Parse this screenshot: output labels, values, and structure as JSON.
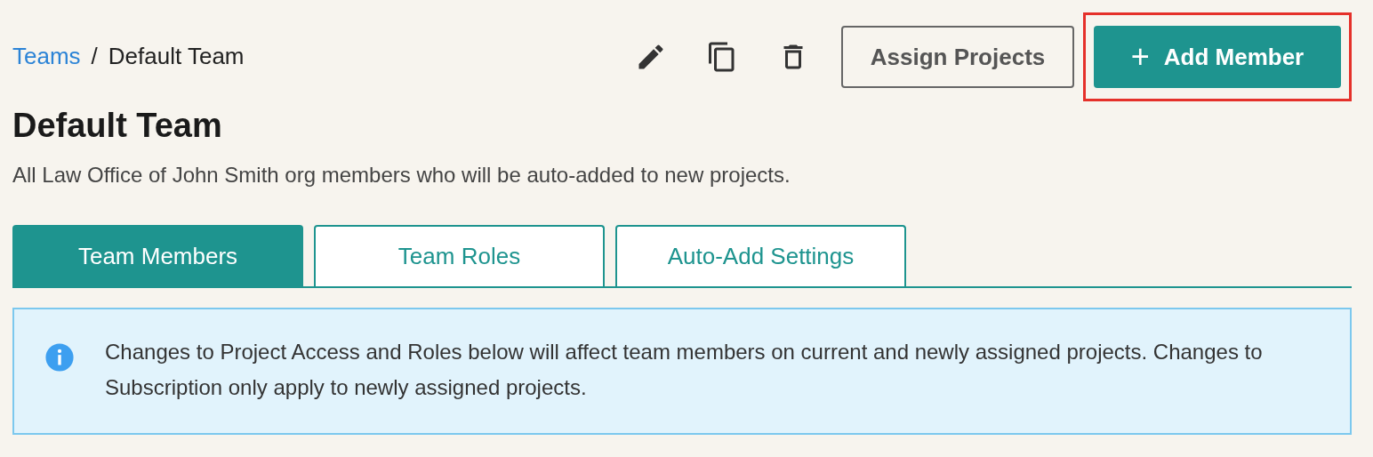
{
  "breadcrumb": {
    "parent": "Teams",
    "separator": "/",
    "current": "Default Team"
  },
  "toolbar": {
    "icons": [
      {
        "kind": "edit"
      },
      {
        "kind": "copy"
      },
      {
        "kind": "delete"
      }
    ],
    "buttons": [
      {
        "label": "Assign Projects",
        "kind": "outline",
        "highlighted": false
      },
      {
        "label": "Add Member",
        "kind": "primary",
        "icon": "+",
        "highlighted": true
      }
    ]
  },
  "title": "Default Team",
  "description": "All Law Office of John Smith org members who will be auto-added to new projects.",
  "tabs": [
    {
      "label": "Team Members",
      "selected": true
    },
    {
      "label": "Team Roles",
      "selected": false
    },
    {
      "label": "Auto-Add Settings",
      "selected": false
    }
  ],
  "notice": {
    "text": "Changes to Project Access and Roles below will affect team members on current and newly assigned projects. Changes to Subscription only apply to newly assigned projects."
  }
}
